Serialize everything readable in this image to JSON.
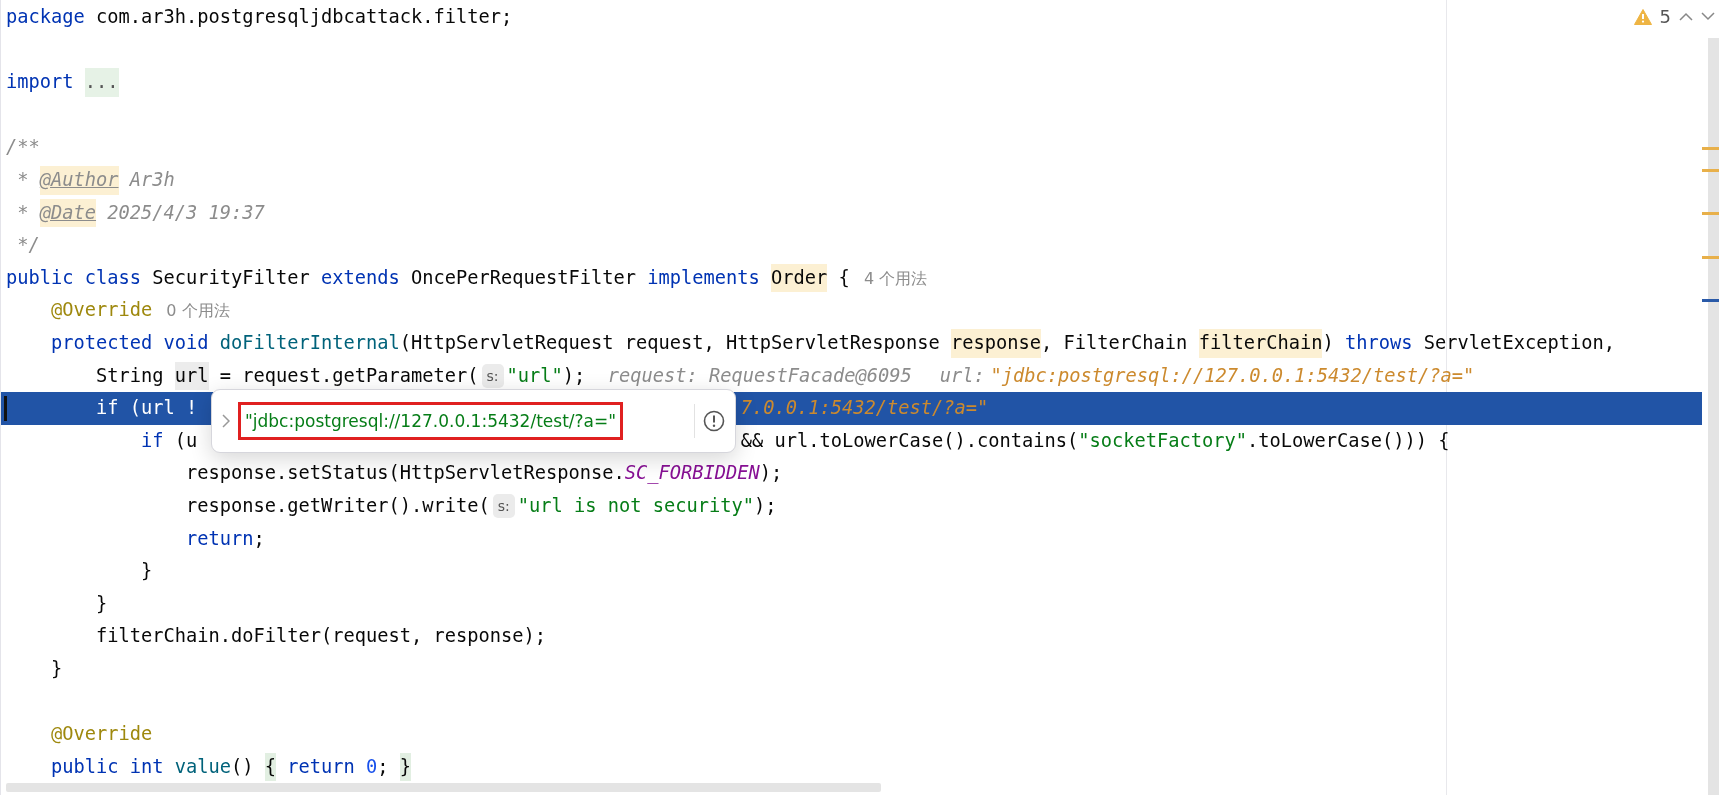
{
  "inspections": {
    "warning_count": "5"
  },
  "lines": [
    {
      "selected": false,
      "tokens": [
        {
          "kind": "keyword",
          "text": "package"
        },
        {
          "kind": "plain",
          "text": " com.ar3h.postgresqljdbcattack.filter;"
        }
      ]
    },
    {
      "selected": false
    },
    {
      "selected": false,
      "tokens": [
        {
          "kind": "keyword",
          "text": "import "
        },
        {
          "kind": "folded",
          "text": "..."
        }
      ]
    },
    {
      "selected": false
    },
    {
      "selected": false,
      "tokens": [
        {
          "kind": "comment",
          "text": "/**"
        }
      ]
    },
    {
      "selected": false,
      "tokens": [
        {
          "kind": "comment",
          "text": " * "
        },
        {
          "kind": "doc_tag_highlighted",
          "text": "@Author"
        },
        {
          "kind": "comment",
          "text": " Ar3h"
        }
      ]
    },
    {
      "selected": false,
      "tokens": [
        {
          "kind": "comment",
          "text": " * "
        },
        {
          "kind": "doc_tag_highlighted",
          "text": "@Date"
        },
        {
          "kind": "comment",
          "text": " 2025/4/3 19:37"
        }
      ]
    },
    {
      "selected": false,
      "tokens": [
        {
          "kind": "comment",
          "text": " */"
        }
      ]
    },
    {
      "selected": false,
      "tokens": [
        {
          "kind": "keyword",
          "text": "public class"
        },
        {
          "kind": "plain",
          "text": " SecurityFilter "
        },
        {
          "kind": "keyword",
          "text": "extends"
        },
        {
          "kind": "plain",
          "text": " OncePerRequestFilter "
        },
        {
          "kind": "keyword",
          "text": "implements "
        },
        {
          "kind": "plain_highlighted",
          "text": "Order"
        },
        {
          "kind": "plain",
          "text": " {"
        },
        {
          "kind": "usage_hint",
          "text": "4 个用法"
        }
      ]
    },
    {
      "selected": false,
      "tokens": [
        {
          "kind": "annotation",
          "text": "    @Override"
        },
        {
          "kind": "usage_hint",
          "text": "0 个用法"
        }
      ]
    },
    {
      "selected": false,
      "tokens": [
        {
          "kind": "keyword",
          "text": "    protected void "
        },
        {
          "kind": "method",
          "text": "doFilterInternal"
        },
        {
          "kind": "plain",
          "text": "(HttpServletRequest request, HttpServletResponse "
        },
        {
          "kind": "plain_highlighted",
          "text": "response"
        },
        {
          "kind": "plain",
          "text": ", FilterChain "
        },
        {
          "kind": "plain_highlighted",
          "text": "filterChain"
        },
        {
          "kind": "plain",
          "text": ") "
        },
        {
          "kind": "keyword",
          "text": "throws"
        },
        {
          "kind": "plain",
          "text": " ServletException,"
        }
      ]
    },
    {
      "selected": false,
      "tokens": [
        {
          "kind": "plain",
          "text": "        String "
        },
        {
          "kind": "caret_word",
          "text": "url"
        },
        {
          "kind": "plain",
          "text": " = request.getParameter("
        },
        {
          "kind": "param_hint",
          "text": "s:"
        },
        {
          "kind": "string",
          "text": "\"url\""
        },
        {
          "kind": "plain",
          "text": ");"
        },
        {
          "kind": "debug_label",
          "text": "request: RequestFacade@6095"
        },
        {
          "kind": "debug_label",
          "text": "url:"
        },
        {
          "kind": "debug_value",
          "text": "\"jdbc:postgresql://127.0.0.1:5432/test/?a=\""
        }
      ]
    },
    {
      "selected": true,
      "tokens": [
        {
          "kind": "keyword",
          "text": "        if"
        },
        {
          "kind": "plain",
          "text": " (url !"
        }
      ],
      "after_popup": [
        {
          "kind": "debug_value",
          "text": "7.0.0.1:5432/test/?a=\""
        }
      ]
    },
    {
      "selected": false,
      "tokens": [
        {
          "kind": "keyword",
          "text": "            if"
        },
        {
          "kind": "plain",
          "text": " (u"
        }
      ],
      "after_popup": [
        {
          "kind": "plain",
          "text": "&& url.toLowerCase().contains("
        },
        {
          "kind": "string",
          "text": "\"socketFactory\""
        },
        {
          "kind": "plain",
          "text": ".toLowerCase())) {"
        }
      ]
    },
    {
      "selected": false,
      "tokens": [
        {
          "kind": "plain",
          "text": "                response.setStatus(HttpServletResponse."
        },
        {
          "kind": "static_field",
          "text": "SC_FORBIDDEN"
        },
        {
          "kind": "plain",
          "text": ");"
        }
      ]
    },
    {
      "selected": false,
      "tokens": [
        {
          "kind": "plain",
          "text": "                response.getWriter().write("
        },
        {
          "kind": "param_hint",
          "text": "s:"
        },
        {
          "kind": "string",
          "text": "\"url is not security\""
        },
        {
          "kind": "plain",
          "text": ");"
        }
      ]
    },
    {
      "selected": false,
      "tokens": [
        {
          "kind": "keyword",
          "text": "                return"
        },
        {
          "kind": "plain",
          "text": ";"
        }
      ]
    },
    {
      "selected": false,
      "tokens": [
        {
          "kind": "plain",
          "text": "            }"
        }
      ]
    },
    {
      "selected": false,
      "tokens": [
        {
          "kind": "plain",
          "text": "        }"
        }
      ]
    },
    {
      "selected": false,
      "tokens": [
        {
          "kind": "plain",
          "text": "        filterChain.doFilter(request, response);"
        }
      ]
    },
    {
      "selected": false,
      "tokens": [
        {
          "kind": "plain",
          "text": "    }"
        }
      ]
    },
    {
      "selected": false
    },
    {
      "selected": false,
      "tokens": [
        {
          "kind": "annotation",
          "text": "    @Override"
        }
      ]
    },
    {
      "selected": false,
      "tokens": [
        {
          "kind": "keyword",
          "text": "    public int "
        },
        {
          "kind": "method",
          "text": "value"
        },
        {
          "kind": "plain",
          "text": "() "
        },
        {
          "kind": "brace_match",
          "text": "{"
        },
        {
          "kind": "keyword",
          "text": " return "
        },
        {
          "kind": "number",
          "text": "0"
        },
        {
          "kind": "plain",
          "text": "; "
        },
        {
          "kind": "brace_match",
          "text": "}"
        }
      ]
    }
  ],
  "popup": {
    "value": "\"jdbc:postgresql://127.0.0.1:5432/test/?a=\"",
    "boxed": true
  }
}
